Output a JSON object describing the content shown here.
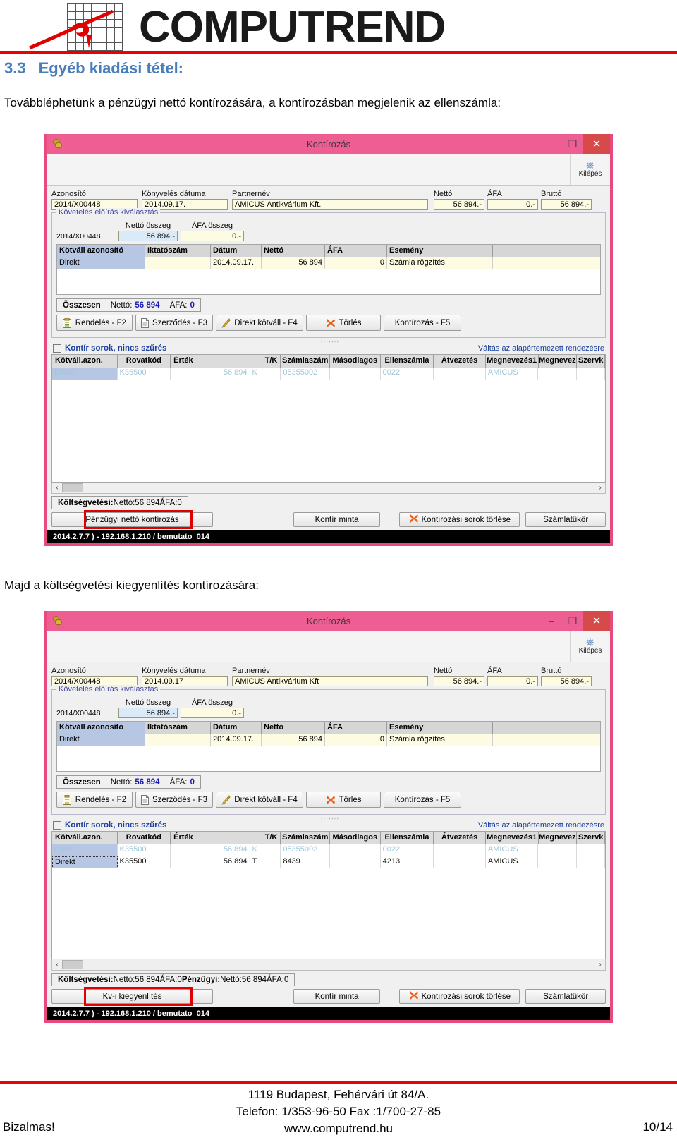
{
  "brand": {
    "name": "COMPUTREND",
    "accent": "#ee0000",
    "heading_color": "#4a7ebb"
  },
  "doc": {
    "section_number": "3.3",
    "section_title": "Egyéb kiadási tétel:",
    "paragraph1": "Továbbléphetünk a pénzügyi nettó kontírozására, a kontírozásban megjelenik az ellenszámla:",
    "paragraph2": "Majd a költségvetési kiegyenlítés kontírozására:"
  },
  "footer": {
    "address": "1119 Budapest, Fehérvári út 84/A.",
    "phone": "Telefon: 1/353-96-50   Fax :1/700-27-85",
    "web": "www.computrend.hu",
    "confidential": "Bizalmas!",
    "page": "10/14"
  },
  "window": {
    "title": "Kontírozás",
    "minimize": "–",
    "maximize": "❐",
    "close": "✕",
    "exit_label": "Kilépés",
    "titlebar_color": "#ef5e93",
    "frame_color": "#e8497f"
  },
  "fields": {
    "azonosito_label": "Azonosító",
    "azonosito_value": "2014/X00448",
    "konyveles_label": "Könyvelés dátuma",
    "konyveles_value_1": "2014.09.17.",
    "konyveles_value_2": "2014.09.17",
    "partnernev_label": "Partnernév",
    "partnernev_value_1": "AMICUS Antikvárium Kft.",
    "partnernev_value_2": "AMICUS Antikvárium Kft",
    "netto_label": "Nettó",
    "netto_value": "56 894.-",
    "afa_label": "ÁFA",
    "afa_value": "0.-",
    "brutto_label": "Bruttó",
    "brutto_value": "56 894.-"
  },
  "groupbox": {
    "title": "Követelés előírás kiválasztás",
    "netto_osszeg_label": "Nettó összeg",
    "afa_osszeg_label": "ÁFA összeg",
    "row_id": "2014/X00448",
    "netto_osszeg_value": "56 894.-",
    "afa_osszeg_value": "0.-"
  },
  "inner_grid": {
    "headers": [
      "Kötváll azonosító",
      "Iktatószám",
      "Dátum",
      "Nettó",
      "ÁFA",
      "Esemény"
    ],
    "rows": [
      {
        "cells": [
          "Direkt",
          "",
          "2014.09.17.",
          "56 894",
          "0",
          "Számla rögzítés"
        ]
      }
    ]
  },
  "totals_top": {
    "label": "Összesen",
    "netto_label": "Nettó:",
    "netto_value": "56 894",
    "afa_label": "ÁFA:",
    "afa_value": "0"
  },
  "action_buttons": [
    {
      "label": "Rendelés - F2",
      "icon": "clipboard-icon"
    },
    {
      "label": "Szerződés - F3",
      "icon": "document-icon"
    },
    {
      "label": "Direkt kötváll - F4",
      "icon": "pencil-icon"
    },
    {
      "label": "Törlés",
      "icon": "red-x-icon"
    },
    {
      "label": "Kontírozás - F5",
      "icon": "none"
    }
  ],
  "filter": {
    "label": "Kontír sorok, nincs szűrés",
    "reset_sort": "Váltás az alapértemezett rendezésre"
  },
  "main_table": {
    "headers": [
      "Kötváll.azon.",
      "Rovatkód",
      "Érték",
      "T/K",
      "Számlaszám",
      "Másodlagos",
      "Ellenszámla",
      "Átvezetés",
      "Megnevezés1",
      "Megnevez",
      "Szervk"
    ],
    "rows_screen1": [
      {
        "state": "dim",
        "cells": [
          "Direkt",
          "K35500",
          "56 894",
          "K",
          "05355002",
          "",
          "0022",
          "",
          "AMICUS",
          "",
          ""
        ]
      }
    ],
    "rows_screen2": [
      {
        "state": "dim",
        "cells": [
          "Direkt",
          "K35500",
          "56 894",
          "K",
          "05355002",
          "",
          "0022",
          "",
          "AMICUS",
          "",
          ""
        ]
      },
      {
        "state": "active",
        "cells": [
          "Direkt",
          "K35500",
          "56 894",
          "T",
          "8439",
          "",
          "4213",
          "",
          "AMICUS",
          "",
          ""
        ]
      }
    ]
  },
  "bottom_totals_1": {
    "label": "Költségvetési:",
    "netto_label": "Nettó:",
    "netto_value": "56 894",
    "afa_label": "ÁFA:",
    "afa_value": "0"
  },
  "bottom_totals_2": {
    "label": "Költségvetési:",
    "netto_label": "Nettó:",
    "netto_value": "56 894",
    "afa_label": "ÁFA:",
    "afa_value": "0",
    "label2": "Pénzügyi:",
    "netto_label2": "Nettó:",
    "netto_value2": "56 894",
    "afa_label2": "ÁFA:",
    "afa_value2": "0"
  },
  "bottom_buttons_1": {
    "highlighted": "Pénzügyi nettó kontírozás",
    "kontir_minta": "Kontír minta",
    "delete_rows": "Kontírozási sorok törlése",
    "szamlatukor": "Számlatükör"
  },
  "bottom_buttons_2": {
    "highlighted": "Kv-i kiegyenlítés",
    "kontir_minta": "Kontír minta",
    "delete_rows": "Kontírozási sorok törlése",
    "szamlatukor": "Számlatükör"
  },
  "statusbar": {
    "text": "2014.2.7.7 ) - 192.168.1.210 / bemutato_014"
  }
}
